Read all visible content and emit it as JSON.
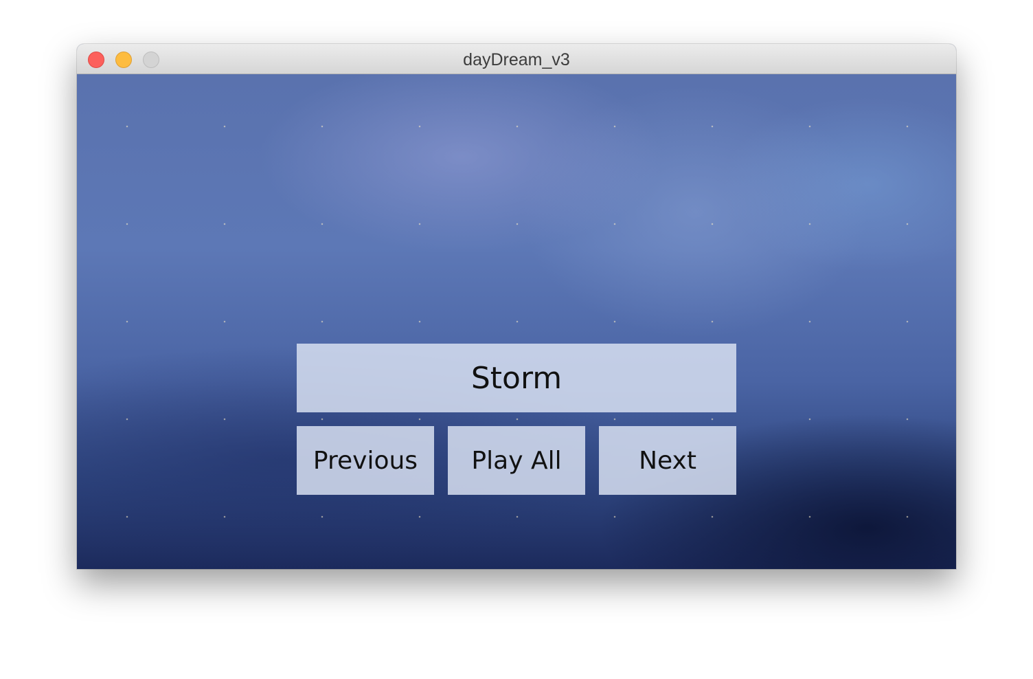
{
  "window": {
    "title": "dayDream_v3"
  },
  "traffic_lights": {
    "close_color": "#fc605c",
    "minimize_color": "#fdbc40",
    "zoom_color": "#d4d4d4"
  },
  "main": {
    "current_title": "Storm",
    "background_theme": "storm clouds",
    "controls": {
      "previous_label": "Previous",
      "play_all_label": "Play All",
      "next_label": "Next"
    }
  }
}
